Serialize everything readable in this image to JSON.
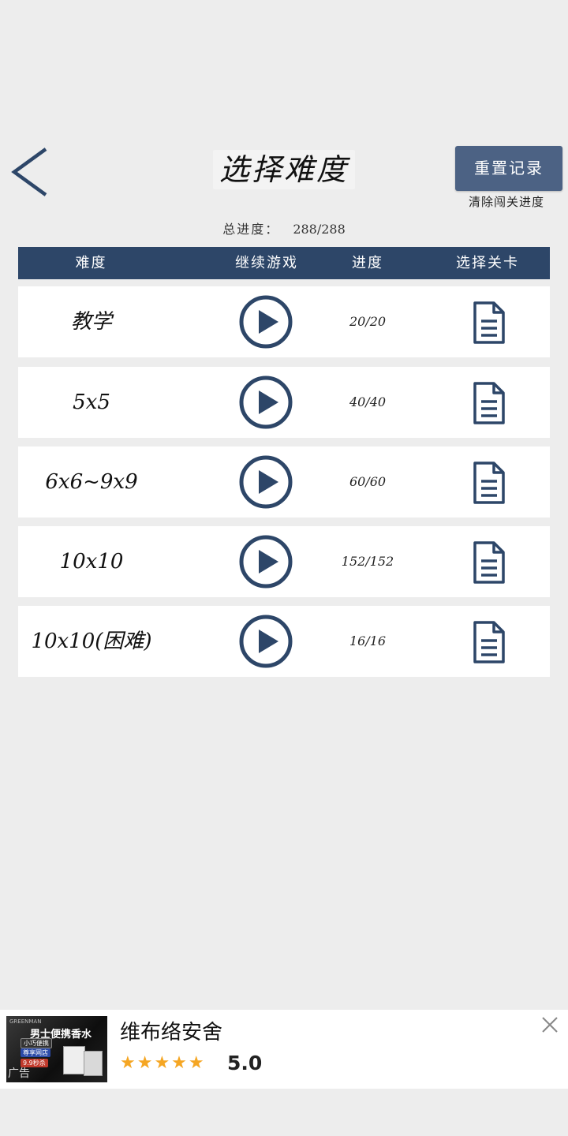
{
  "header": {
    "title": "选择难度",
    "reset_button": "重置记录",
    "reset_subtitle": "清除闯关进度"
  },
  "total_progress": {
    "label": "总进度：",
    "value": "288/288"
  },
  "table": {
    "columns": [
      "难度",
      "继续游戏",
      "进度",
      "选择关卡"
    ],
    "rows": [
      {
        "difficulty": "教学",
        "progress": "20/20"
      },
      {
        "difficulty": "5x5",
        "progress": "40/40"
      },
      {
        "difficulty": "6x6~9x9",
        "progress": "60/60"
      },
      {
        "difficulty": "10x10",
        "progress": "152/152"
      },
      {
        "difficulty": "10x10(困难)",
        "progress": "16/16"
      }
    ]
  },
  "ad": {
    "image_text": {
      "brand": "GREENMAN",
      "headline": "男士便携香水",
      "tags": [
        "小巧便携",
        "尊享网店",
        "9.9秒杀"
      ],
      "label": "广告"
    },
    "title": "维布络安舍",
    "stars": "★★★★★",
    "rating": "5.0"
  },
  "colors": {
    "accent": "#2d4668",
    "button": "#4c6284",
    "background": "#ededed",
    "star": "#f5a623"
  },
  "icons": [
    "back-arrow-icon",
    "play-icon",
    "document-icon",
    "close-icon"
  ]
}
